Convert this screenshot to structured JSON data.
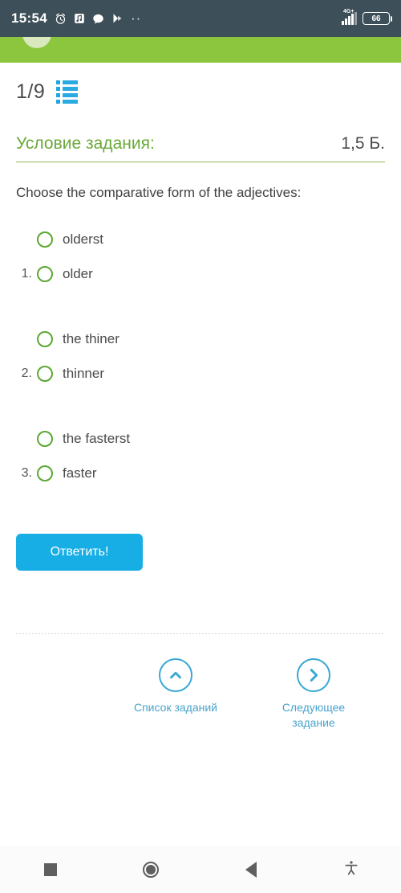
{
  "statusbar": {
    "time": "15:54",
    "icons": [
      "alarm-icon",
      "note-icon",
      "message-icon",
      "play-icon",
      "more-dots-icon"
    ],
    "network_label": "4G+",
    "battery_level": "66"
  },
  "brandbar": {
    "avatar": "user-avatar"
  },
  "pager": {
    "position": "1/9",
    "list_icon": "task-list-icon"
  },
  "task": {
    "title": "Условие задания:",
    "points": "1,5 Б.",
    "question": "Choose the comparative form of the adjectives:"
  },
  "option_groups": [
    {
      "options": [
        {
          "num": "",
          "label": "olderst"
        },
        {
          "num": "1.",
          "label": "older"
        }
      ]
    },
    {
      "options": [
        {
          "num": "",
          "label": "the thiner"
        },
        {
          "num": "2.",
          "label": "thinner"
        }
      ]
    },
    {
      "options": [
        {
          "num": "",
          "label": "the fasterst"
        },
        {
          "num": "3.",
          "label": "faster"
        }
      ]
    }
  ],
  "actions": {
    "submit_label": "Ответить!"
  },
  "bottom_nav": [
    {
      "icon": "chevron-up-circle-icon",
      "label": "Список заданий"
    },
    {
      "icon": "chevron-right-circle-icon",
      "label": "Следующее задание"
    }
  ],
  "android_nav": {
    "recents": "recents-square-icon",
    "home": "home-circle-icon",
    "back": "back-triangle-icon",
    "accessibility": "accessibility-icon"
  },
  "colors": {
    "brand_green": "#8cc63e",
    "title_green": "#6aa939",
    "radio_green": "#5ba832",
    "accent_blue": "#17aee5",
    "link_blue": "#4aa3cc",
    "statusbar_bg": "#3d4f58"
  }
}
